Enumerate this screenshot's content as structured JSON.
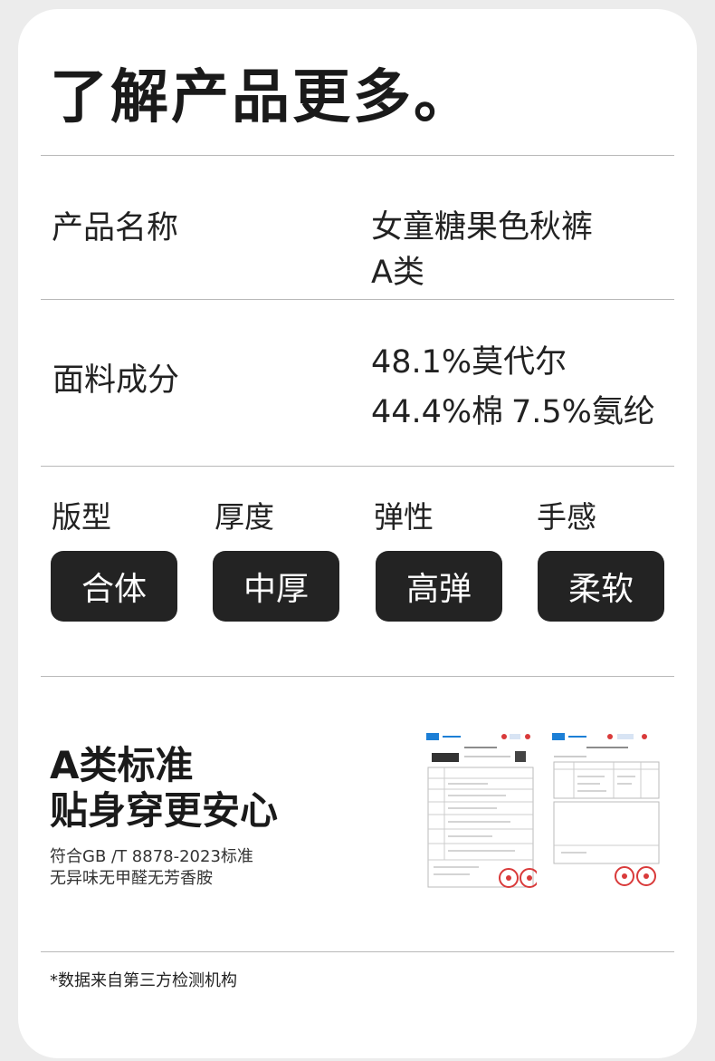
{
  "heading": "了解产品更多。",
  "product_name": {
    "label": "产品名称",
    "value_line1": "女童糖果色秋裤",
    "value_line2": "A类"
  },
  "fabric": {
    "label": "面料成分",
    "line1": "48.1%莫代尔",
    "line2_part1": "44.4%棉",
    "line2_part2": "7.5%氨纶"
  },
  "attributes": [
    {
      "label": "版型",
      "value": "合体"
    },
    {
      "label": "厚度",
      "value": "中厚"
    },
    {
      "label": "弹性",
      "value": "高弹"
    },
    {
      "label": "手感",
      "value": "柔软"
    }
  ],
  "standard": {
    "headline1": "A类标准",
    "headline2": "贴身穿更安心",
    "line1": "符合GB /T 8878-2023标准",
    "line2": "无异味无甲醛无芳香胺"
  },
  "reports": [
    {
      "name": "test-report-page-1",
      "icon": "document-icon"
    },
    {
      "name": "test-report-page-2",
      "icon": "document-icon"
    }
  ],
  "footnote": "*数据来自第三方检测机构",
  "colors": {
    "background": "#ececec",
    "card": "#ffffff",
    "pill": "#232323",
    "pill_text": "#ffffff",
    "stamp": "#d93a3a",
    "divider": "#b9b9b9"
  }
}
